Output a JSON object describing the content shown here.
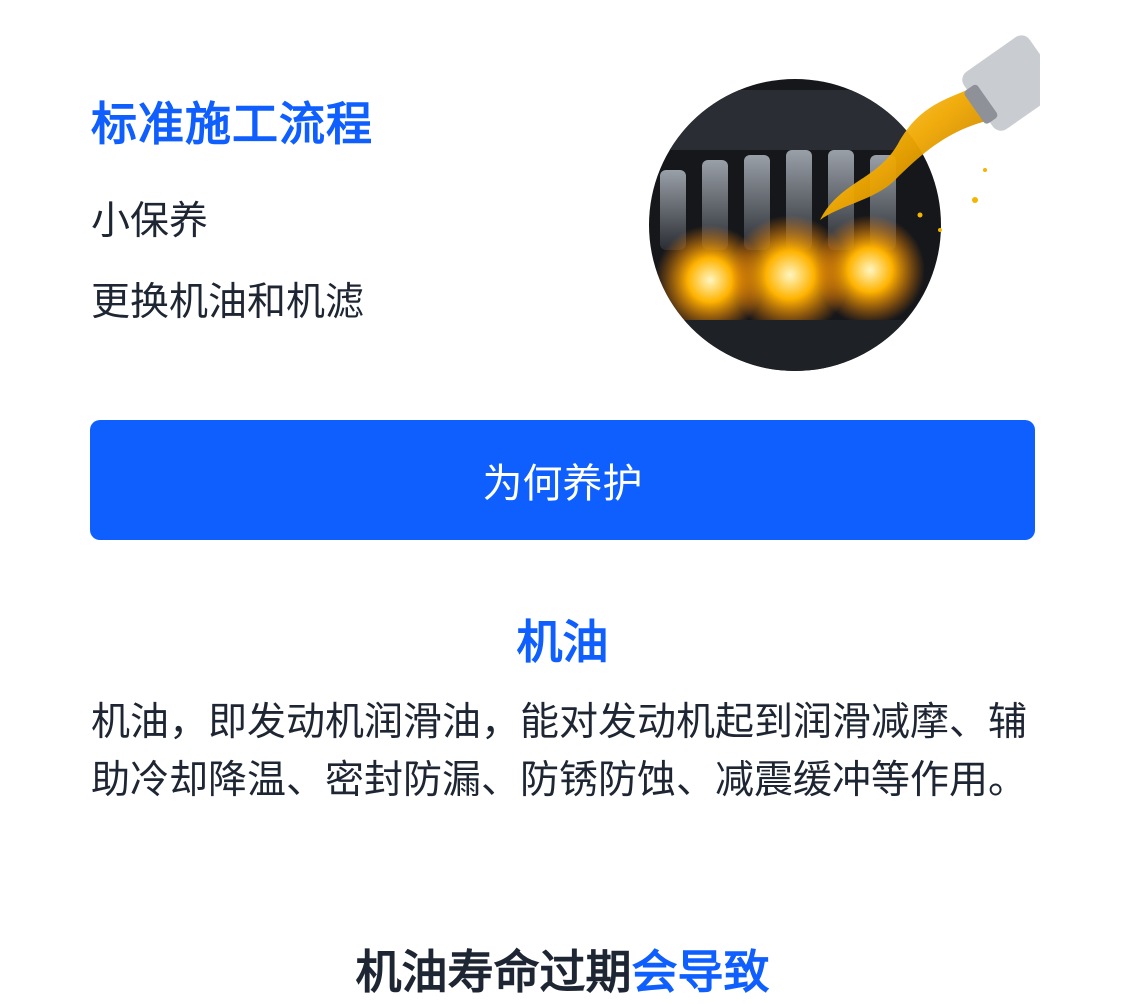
{
  "section": {
    "title": "标准施工流程",
    "subtitle": "小保养",
    "description": "更换机油和机滤"
  },
  "hero_image": {
    "subject": "engine-oil-pour"
  },
  "why_button": {
    "label": "为何养护"
  },
  "oil": {
    "heading": "机油",
    "paragraph": "机油，即发动机润滑油，能对发动机起到润滑减摩、辅助冷却降温、密封防漏、防锈防蚀、减震缓冲等作用。"
  },
  "expiry": {
    "heading_part1": "机油寿命过期",
    "heading_part2": "会导致"
  },
  "colors": {
    "accent": "#0f5fff",
    "text": "#1f2633",
    "background": "#ffffff"
  }
}
